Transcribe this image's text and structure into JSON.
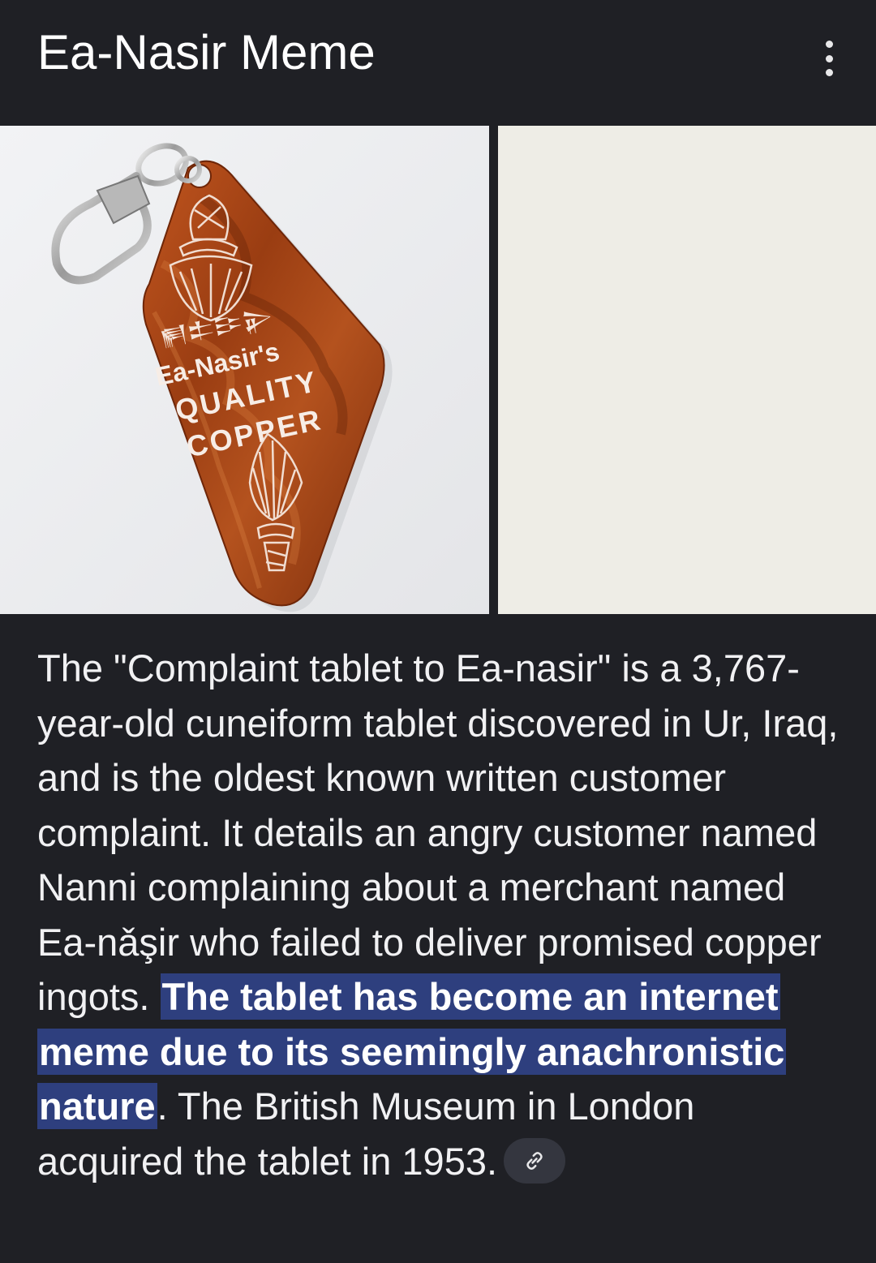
{
  "header": {
    "title": "Ea-Nasir Meme",
    "menu_icon": "more-vert-icon"
  },
  "images": {
    "keychain": {
      "cuneiform": "𒂍𒉺𒄿𒉌",
      "line1": "Ea-Nasir's",
      "line2": "QUALITY",
      "line3": "COPPER"
    }
  },
  "article": {
    "text_before": "The \"Complaint tablet to Ea-nasir\" is a 3,767-year-old cuneiform tablet discovered in Ur, Iraq, and is the oldest known written customer complaint. It details an angry customer named Nanni complaining about a merchant named Ea-nǎşir who failed to deliver promised copper ingots. ",
    "highlighted": "The tablet has become an internet meme due to its seemingly anachronistic nature",
    "text_after": ". The British Museum in London acquired the tablet in 1953.",
    "link_icon": "link-icon"
  },
  "colors": {
    "background": "#1f2025",
    "highlight": "#2e3f7e",
    "chip": "#34363f",
    "keychain": "#a8461a"
  }
}
